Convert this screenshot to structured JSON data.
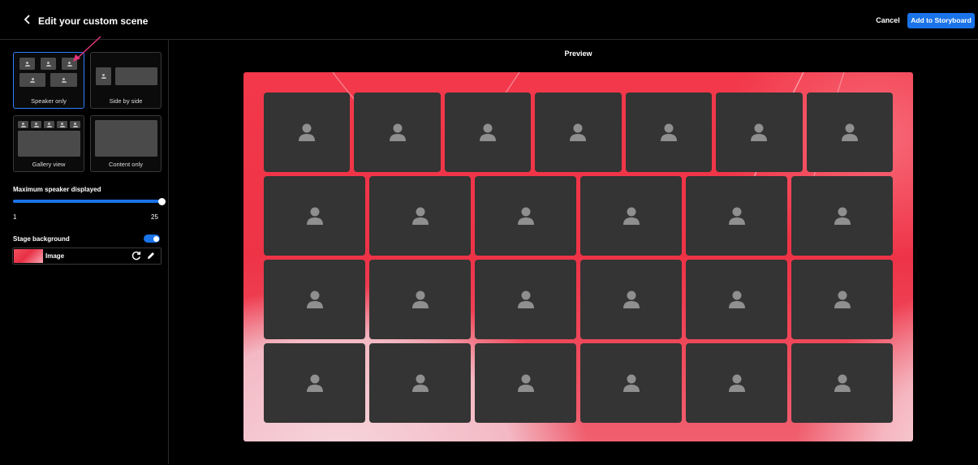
{
  "header": {
    "title": "Edit your custom scene",
    "cancel_label": "Cancel",
    "add_label": "Add to Storyboard"
  },
  "sidebar": {
    "layouts": [
      {
        "label": "Speaker only",
        "selected": true
      },
      {
        "label": "Side by side",
        "selected": false
      },
      {
        "label": "Gallery view",
        "selected": false
      },
      {
        "label": "Content only",
        "selected": false
      }
    ],
    "max_speaker": {
      "label": "Maximum speaker displayed",
      "min": "1",
      "max": "25",
      "value": 25
    },
    "stage_background": {
      "label": "Stage background",
      "enabled": true,
      "type_label": "Image"
    }
  },
  "main": {
    "preview_label": "Preview",
    "participant_rows": [
      7,
      6,
      6,
      6
    ]
  },
  "colors": {
    "accent": "#1a73e8",
    "tile": "#343434",
    "stage_red": "#ee3347"
  }
}
